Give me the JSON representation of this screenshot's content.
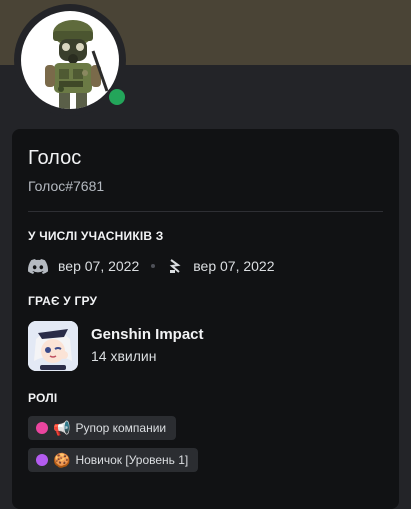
{
  "profile": {
    "display_name": "Голос",
    "username": "Голос#7681",
    "status": "online",
    "status_color": "#23a55a",
    "banner_color": "#4a4436"
  },
  "member_since": {
    "title": "У ЧИСЛІ УЧАСНИКІВ З",
    "discord_date": "вер 07, 2022",
    "server_date": "вер 07, 2022"
  },
  "activity": {
    "title": "ГРАЄ У ГРУ",
    "game_name": "Genshin Impact",
    "elapsed": "14 хвилин"
  },
  "roles": {
    "title": "РОЛІ",
    "items": [
      {
        "name": "Рупор компании",
        "color": "#eb459f",
        "emoji": "📢"
      },
      {
        "name": "Новичок [Уровень 1]",
        "color": "#b45cf0",
        "emoji": "🍪"
      }
    ]
  }
}
